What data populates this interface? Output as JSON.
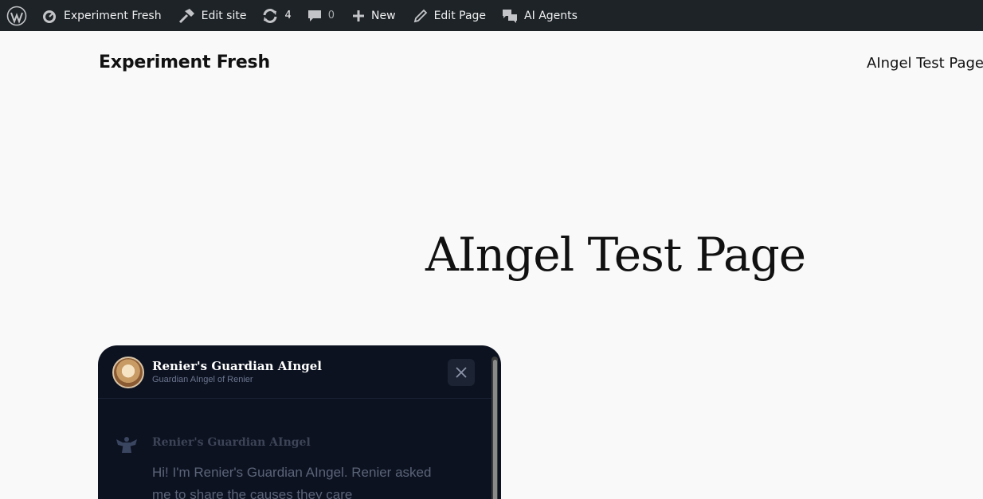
{
  "admin_bar": {
    "site_name": "Experiment Fresh",
    "edit_site": "Edit site",
    "updates_count": "4",
    "comments_count": "0",
    "new_label": "New",
    "edit_page": "Edit Page",
    "ai_agents": "AI Agents"
  },
  "header": {
    "site_title": "Experiment Fresh",
    "nav_link": "AIngel Test Page"
  },
  "main": {
    "page_title": "AIngel Test Page"
  },
  "chat_widget": {
    "name": "Renier's Guardian AIngel",
    "subtitle": "Guardian AIngel of Renier",
    "message_author": "Renier's Guardian AIngel",
    "message_text": "Hi! I'm Renier's Guardian AIngel. Renier asked me to share the causes they care"
  },
  "colors": {
    "admin_bar_bg": "#1d2327",
    "page_bg": "#f9f9f9",
    "widget_bg": "#0c1220"
  }
}
